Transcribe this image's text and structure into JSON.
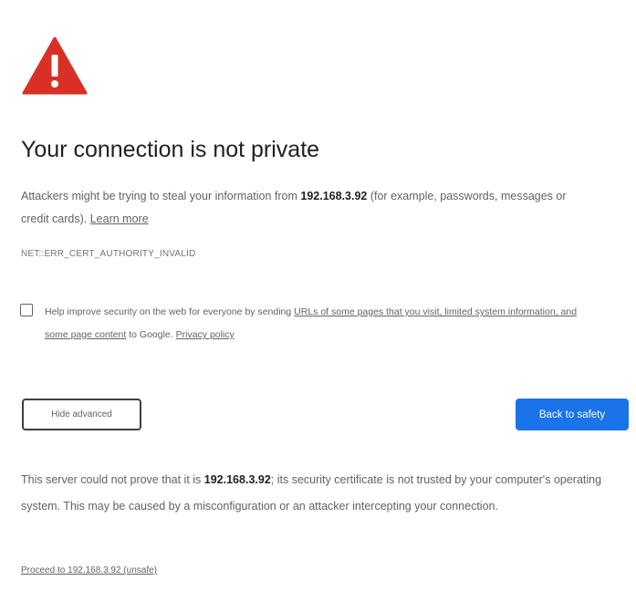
{
  "colors": {
    "warning_red": "#d93025",
    "primary_blue": "#1a73e8",
    "text_gray": "#5f6368",
    "title_dark": "#202124"
  },
  "icon": "warning-triangle-icon",
  "heading": "Your connection is not private",
  "description": {
    "before_host": "Attackers might be trying to steal your information from ",
    "host": "192.168.3.92",
    "after_host": " (for example, passwords, messages or credit cards). ",
    "learn_more": "Learn more"
  },
  "error_code": "NET::ERR_CERT_AUTHORITY_INVALID",
  "checkbox": {
    "checked": false,
    "text_before": "Help improve security on the web for everyone by sending ",
    "link1": "URLs of some pages that you visit, limited system information, and some page content",
    "text_middle": " to Google. ",
    "link2": "Privacy policy"
  },
  "buttons": {
    "hide_advanced": "Hide advanced",
    "back_to_safety": "Back to safety"
  },
  "details": {
    "before_host": "This server could not prove that it is ",
    "host": "192.168.3.92",
    "after_host": "; its security certificate is not trusted by your computer's operating system. This may be caused by a misconfiguration or an attacker intercepting your connection."
  },
  "proceed_link": "Proceed to 192.168.3.92 (unsafe)"
}
